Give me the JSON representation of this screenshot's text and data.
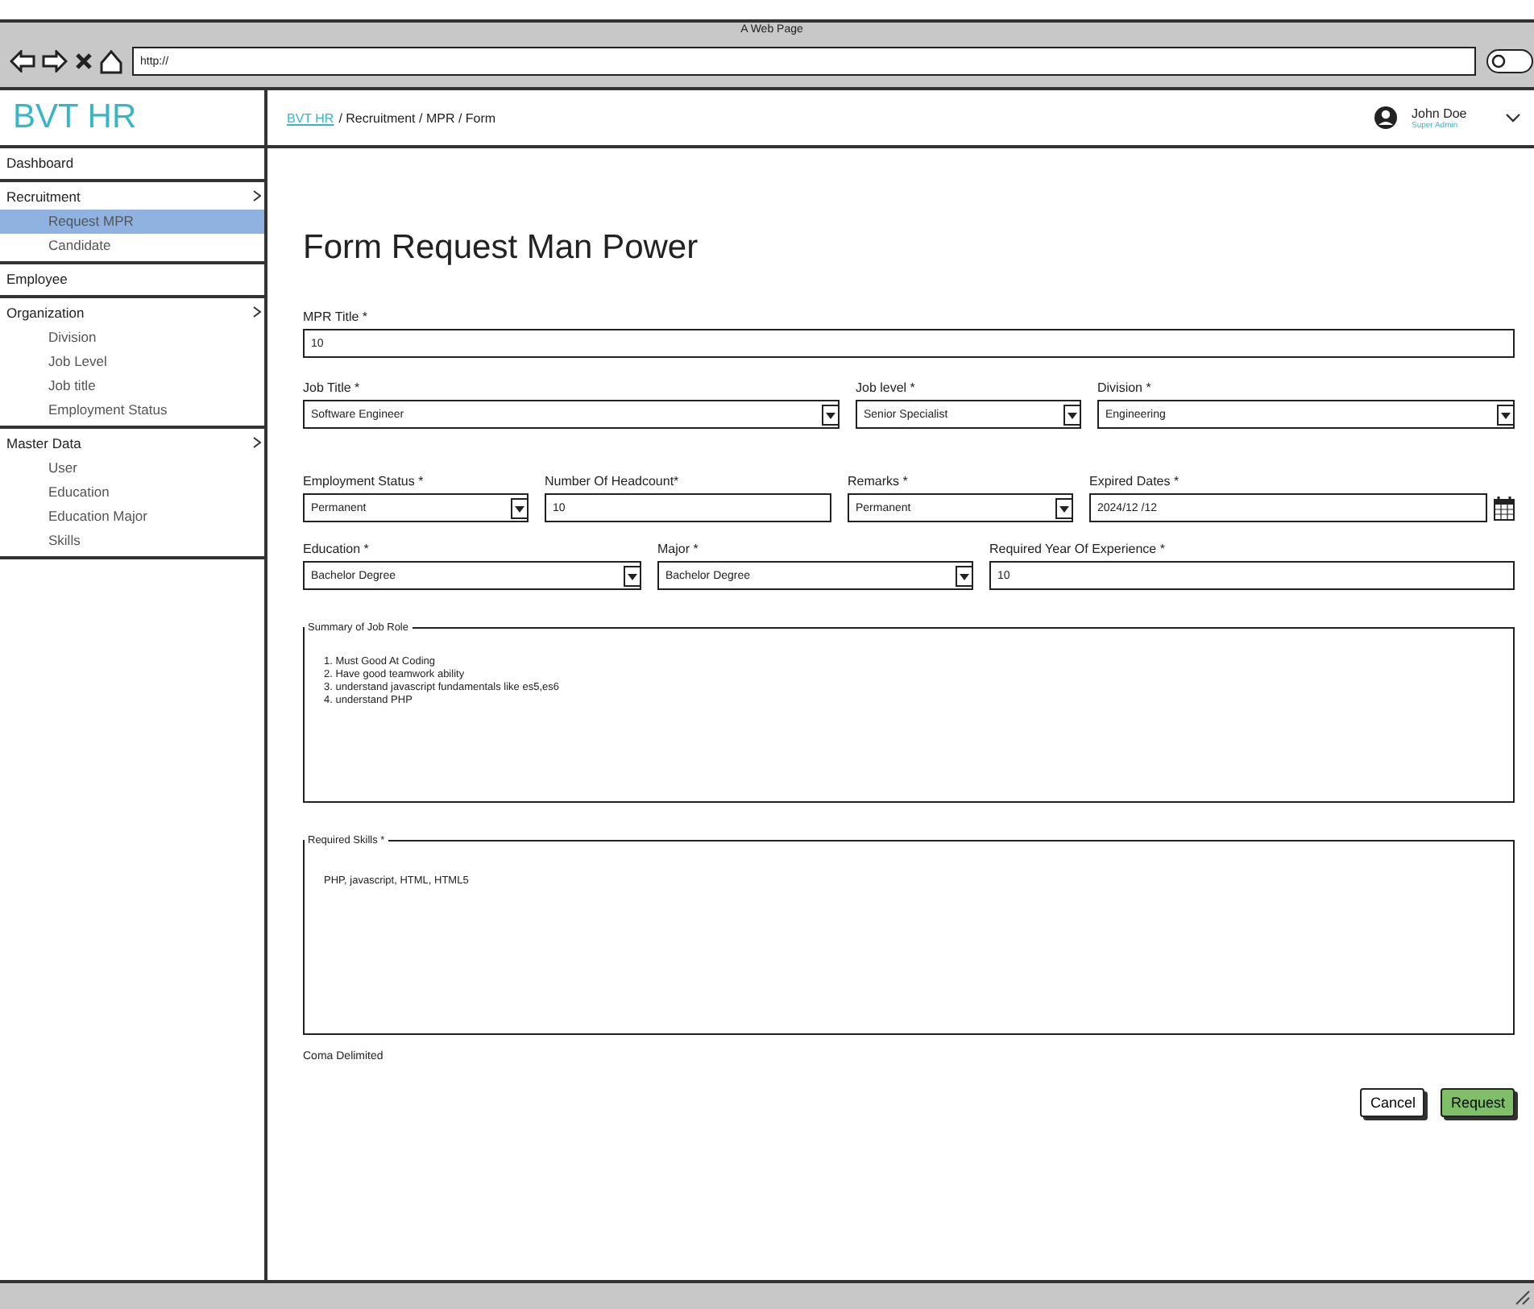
{
  "browser": {
    "title": "A Web Page",
    "url": "http://"
  },
  "header": {
    "logo": "BVT HR",
    "breadcrumb": [
      {
        "label": "BVT HR",
        "link": true
      },
      {
        "label": "/ Recruitment / MPR / Form",
        "link": false
      }
    ],
    "user": {
      "name": "John Doe",
      "role": "Super Admin"
    }
  },
  "sidebar": {
    "groups": [
      {
        "label": "Dashboard",
        "selected": false
      },
      {
        "label": "Recruitment",
        "selected": false,
        "children": [
          {
            "label": "Request MPR",
            "selected": true
          },
          {
            "label": "Candidate",
            "selected": false
          }
        ]
      },
      {
        "label": "Employee",
        "selected": false
      },
      {
        "label": "Organization",
        "selected": false,
        "children": [
          {
            "label": "Division",
            "selected": false
          },
          {
            "label": "Job Level",
            "selected": false
          },
          {
            "label": "Job title",
            "selected": false
          },
          {
            "label": "Employment Status",
            "selected": false
          }
        ]
      },
      {
        "label": "Master Data",
        "selected": false,
        "children": [
          {
            "label": "User",
            "selected": false
          },
          {
            "label": "Education",
            "selected": false
          },
          {
            "label": "Education Major",
            "selected": false
          },
          {
            "label": "Skills",
            "selected": false
          }
        ]
      }
    ]
  },
  "form": {
    "title": "Form Request Man Power",
    "rows": [
      [
        {
          "label": "MPR Title *",
          "kind": "text",
          "value": "10"
        }
      ],
      [
        {
          "label": "Job Title *",
          "kind": "select",
          "value": "Software Engineer"
        },
        {
          "label": "Job level *",
          "kind": "select",
          "value": "Senior Specialist"
        },
        {
          "label": "Division *",
          "kind": "select",
          "value": "Engineering"
        }
      ],
      [
        {
          "label": "Employment Status *",
          "kind": "select",
          "value": "Permanent"
        },
        {
          "label": "Number Of Headcount*",
          "kind": "text",
          "value": "10"
        },
        {
          "label": "Remarks *",
          "kind": "select",
          "value": "Permanent"
        },
        {
          "label": "Expired Dates *",
          "kind": "date",
          "value": "2024/12 /12"
        }
      ],
      [
        {
          "label": "Education *",
          "kind": "select",
          "value": "Bachelor Degree"
        },
        {
          "label": "Major *",
          "kind": "select",
          "value": "Bachelor Degree"
        },
        {
          "label": "Required Year Of Experience *",
          "kind": "text",
          "value": "10"
        }
      ]
    ],
    "areas": [
      {
        "label": "Summary of Job Role",
        "lines": [
          "1. Must Good At Coding",
          "2. Have good teamwork ability",
          "3. understand javascript fundamentals like es5,es6",
          "4. understand PHP"
        ]
      },
      {
        "label": "Required Skills *",
        "lines": [
          "PHP, javascript, HTML, HTML5"
        ]
      }
    ],
    "hint": "Coma Delimited",
    "buttons": [
      {
        "label": "Cancel",
        "kind": "secondary"
      },
      {
        "label": "Request",
        "kind": "primary"
      }
    ]
  }
}
